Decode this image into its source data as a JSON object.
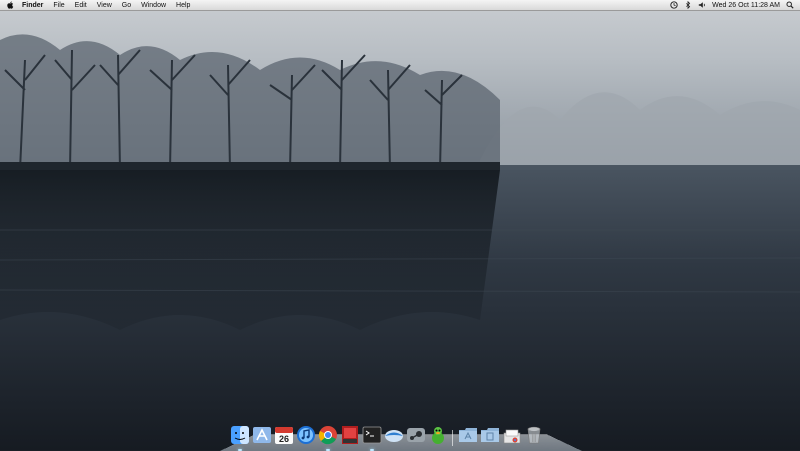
{
  "menubar": {
    "app_name": "Finder",
    "menus": [
      "File",
      "Edit",
      "View",
      "Go",
      "Window",
      "Help"
    ],
    "clock": "Wed 26 Oct  11:28 AM"
  },
  "dock": {
    "calendar_day": "26"
  },
  "colors": {
    "menubar": "#e6e6e6",
    "fog": "#c7ccd1",
    "water": "#1a1f26"
  }
}
